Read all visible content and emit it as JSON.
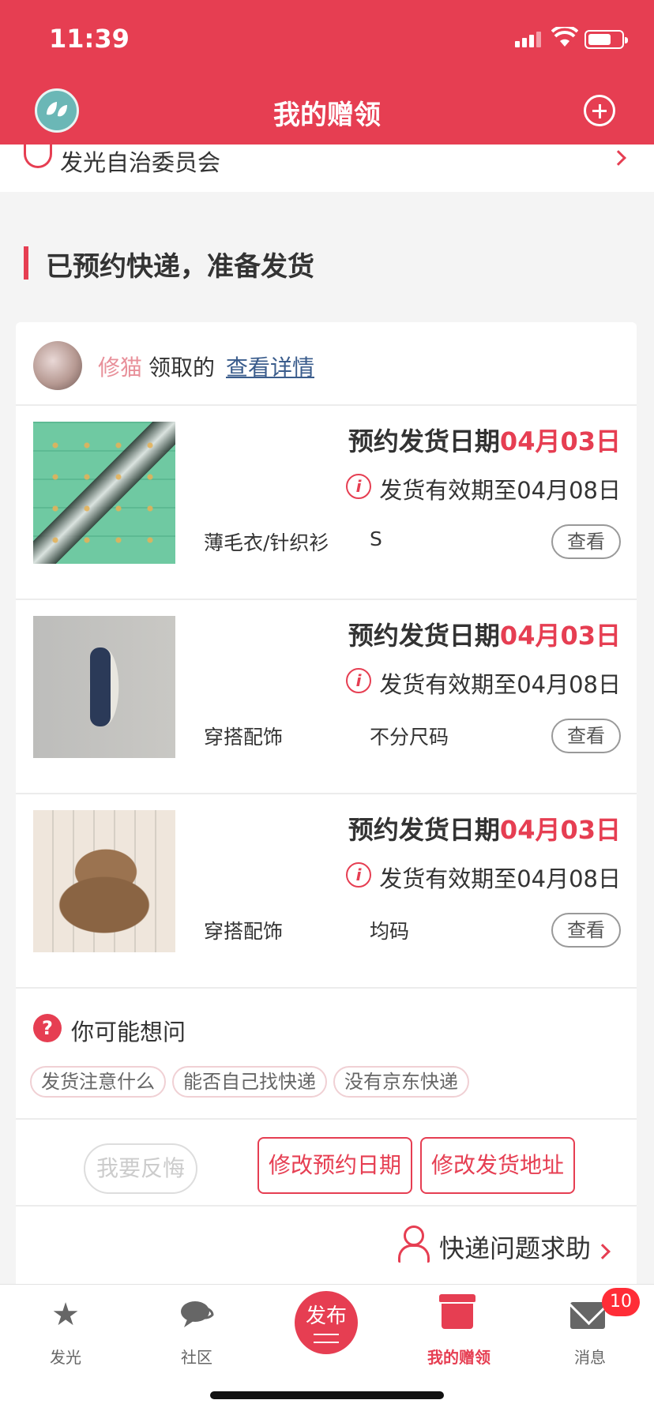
{
  "status_bar": {
    "time": "11:39"
  },
  "header": {
    "title": "我的赠领"
  },
  "committee": {
    "label": "发光自治委员会"
  },
  "section_title": "已预约快递，准备发货",
  "receiver": {
    "name": "修猫",
    "text": "领取的",
    "link": "查看详情"
  },
  "items": [
    {
      "ship_label": "预约发货日期",
      "ship_date": "04月03日",
      "valid_until": "发货有效期至04月08日",
      "category": "薄毛衣/针织衫",
      "size": "S",
      "view_label": "查看"
    },
    {
      "ship_label": "预约发货日期",
      "ship_date": "04月03日",
      "valid_until": "发货有效期至04月08日",
      "category": "穿搭配饰",
      "size": "不分尺码",
      "view_label": "查看"
    },
    {
      "ship_label": "预约发货日期",
      "ship_date": "04月03日",
      "valid_until": "发货有效期至04月08日",
      "category": "穿搭配饰",
      "size": "均码",
      "view_label": "查看"
    }
  ],
  "faq": {
    "title": "你可能想问",
    "chips": [
      "发货注意什么",
      "能否自己找快递",
      "没有京东快递"
    ]
  },
  "actions": {
    "regret": "我要反悔",
    "change_date": "修改预约日期",
    "change_address": "修改发货地址"
  },
  "help": {
    "label": "快递问题求助"
  },
  "tabbar": {
    "tabs": [
      "发光",
      "社区",
      "发布",
      "我的赠领",
      "消息"
    ],
    "active": "我的赠领",
    "message_badge": "10"
  },
  "colors": {
    "accent": "#e63e52"
  },
  "icons": [
    "leaf-logo-icon",
    "add-icon",
    "committee-icon",
    "info-icon",
    "question-icon",
    "person-icon",
    "star-icon",
    "chat-icon",
    "gift-icon",
    "mail-icon"
  ]
}
